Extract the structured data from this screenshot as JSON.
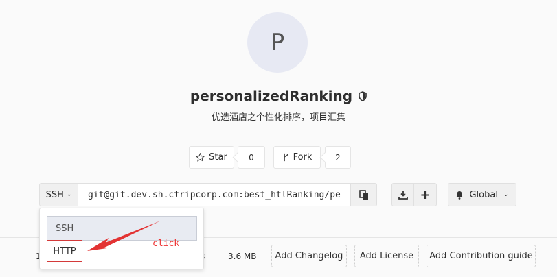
{
  "project": {
    "avatar_letter": "P",
    "title": "personalizedRanking",
    "description": "优选酒店之个性化排序，项目汇集"
  },
  "actions": {
    "star_label": "Star",
    "star_count": "0",
    "fork_label": "Fork",
    "fork_count": "2"
  },
  "clone": {
    "protocol": "SSH",
    "url": "git@git.dev.sh.ctripcorp.com:best_htlRanking/per"
  },
  "notification": {
    "label": "Global"
  },
  "dropdown": {
    "options": [
      "SSH",
      "HTTP"
    ],
    "selected": "SSH",
    "highlighted": "HTTP"
  },
  "annotation": {
    "text": "click",
    "color": "#e33333"
  },
  "bottom": {
    "stat_left": "1",
    "stat_files_suffix": "s",
    "size": "3.6 MB",
    "changelog_label": "Add Changelog",
    "license_label": "Add License",
    "contrib_label": "Add Contribution guide"
  },
  "icons": {
    "visibility": "shield-icon",
    "star": "star-icon",
    "fork": "fork-icon",
    "copy": "clipboard-icon",
    "download": "download-icon",
    "add": "plus-icon",
    "bell": "bell-icon",
    "chevron": "chevron-down-icon"
  }
}
